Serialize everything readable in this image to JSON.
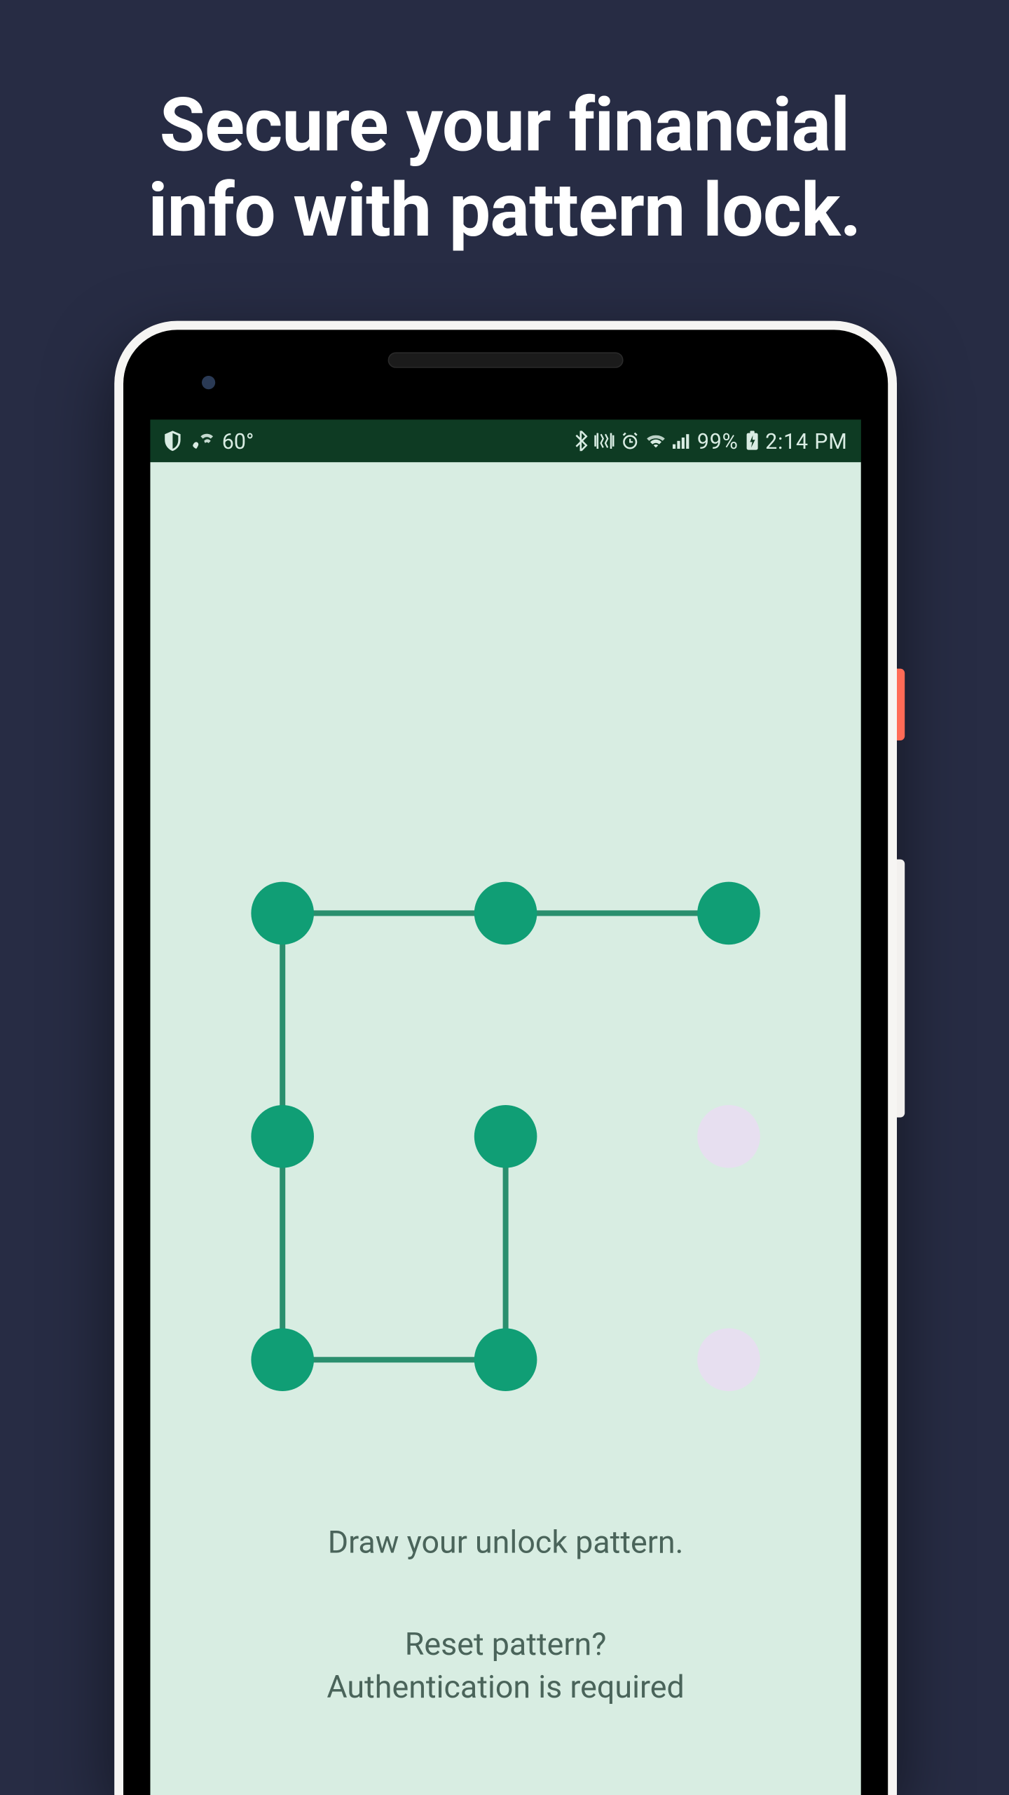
{
  "promo": {
    "headline_line1": "Secure your financial",
    "headline_line2": "info with pattern lock."
  },
  "status_bar": {
    "temperature": "60°",
    "battery_pct": "99%",
    "time": "2:14 PM"
  },
  "screen": {
    "instruction": "Draw your unlock pattern.",
    "reset_prompt": "Reset pattern?",
    "auth_required": "Authentication is required"
  },
  "colors": {
    "background": "#272c44",
    "status_bar_bg": "#0e3b23",
    "app_bg": "#d8ede2",
    "dot_active": "#109e75",
    "dot_inactive": "#e7dff0",
    "line": "#2a8f6e",
    "text_muted": "#4a645a"
  },
  "pattern": {
    "grid": 3,
    "active_dots": [
      0,
      1,
      2,
      3,
      4,
      6,
      7
    ],
    "inactive_dots": [
      5,
      8
    ],
    "path_indices": [
      2,
      1,
      0,
      3,
      6,
      7,
      4
    ]
  }
}
